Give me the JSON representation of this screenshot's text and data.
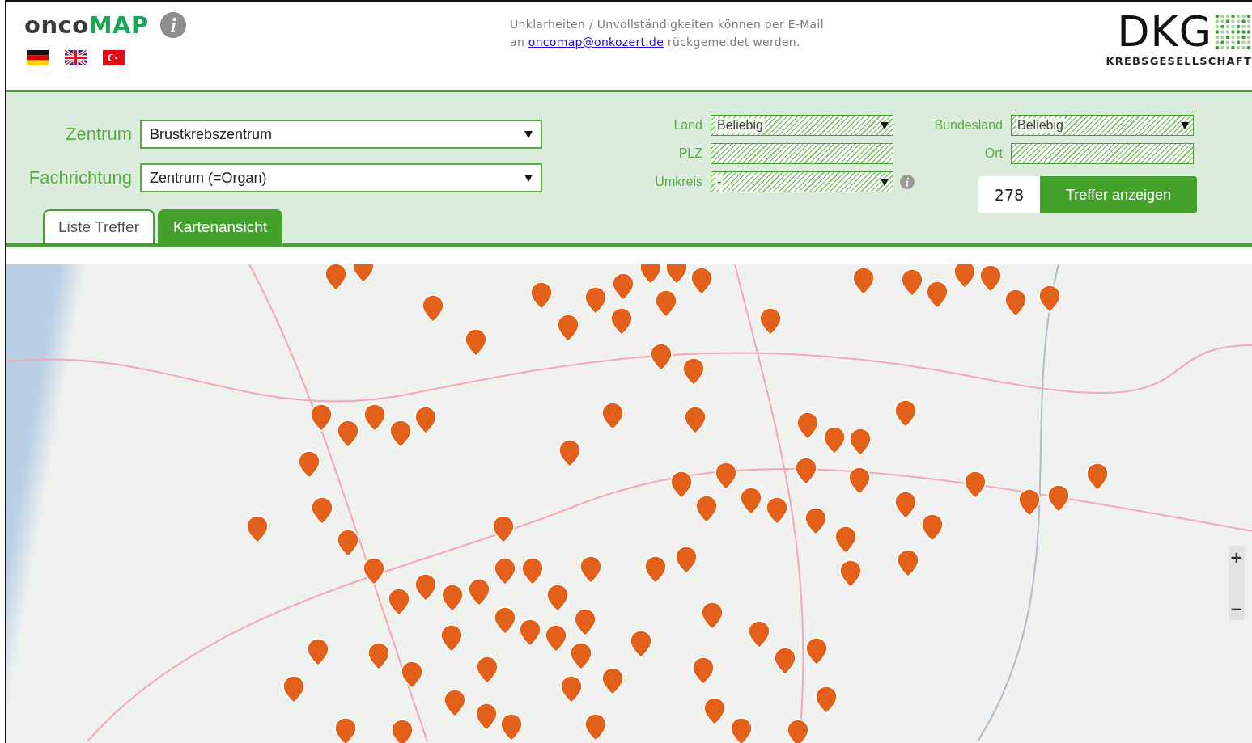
{
  "header": {
    "logo_prefix": "onco",
    "logo_main": "MAP",
    "notice": {
      "line1": "Unklarheiten / Unvollständigkeiten können per E-Mail",
      "prefix": "an",
      "email": "oncomap@onkozert.de",
      "suffix": "rückgemeldet werden."
    },
    "brand": {
      "name": "DKG",
      "subtitle": "KREBSGESELLSCHAFT"
    }
  },
  "filters": {
    "zentrum": {
      "label": "Zentrum",
      "value": "Brustkrebszentrum"
    },
    "fachrichtung": {
      "label": "Fachrichtung",
      "value": "Zentrum (=Organ)"
    },
    "land": {
      "label": "Land",
      "value": "Beliebig"
    },
    "plz": {
      "label": "PLZ"
    },
    "umkreis": {
      "label": "Umkreis",
      "value": "-"
    },
    "bundesland": {
      "label": "Bundesland",
      "value": "Beliebig"
    },
    "ort": {
      "label": "Ort"
    }
  },
  "result": {
    "count": "278",
    "button": "Treffer anzeigen"
  },
  "tabs": [
    {
      "label": "Liste Treffer",
      "selected": false
    },
    {
      "label": "Kartenansicht",
      "selected": true
    }
  ],
  "map": {
    "zoom_in": "+",
    "zoom_out": "−"
  }
}
